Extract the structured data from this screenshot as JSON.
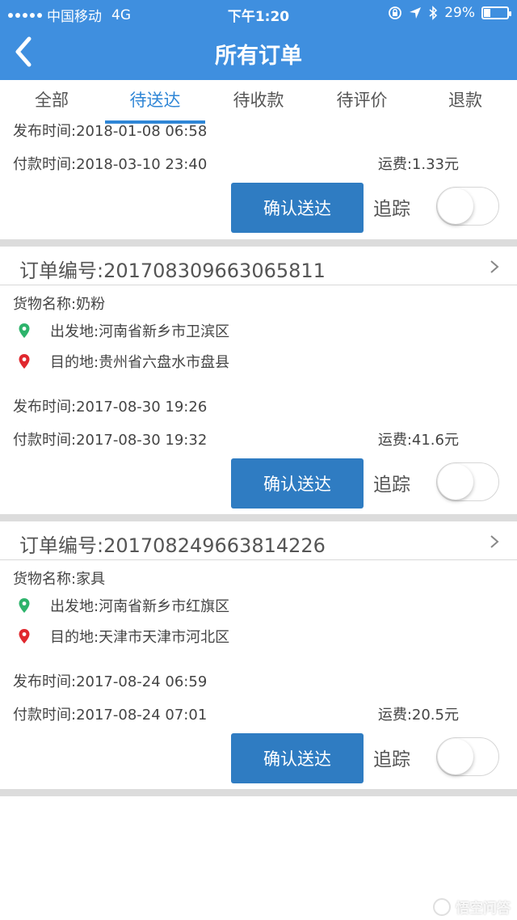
{
  "status_bar": {
    "carrier": "中国移动",
    "network": "4G",
    "time": "下午1:20",
    "battery": "29%",
    "battery_level": 0.29
  },
  "header": {
    "title": "所有订单",
    "back_icon": "back-arrow-icon"
  },
  "tabs": [
    {
      "label": "全部",
      "active": false
    },
    {
      "label": "待送达",
      "active": true
    },
    {
      "label": "待收款",
      "active": false
    },
    {
      "label": "待评价",
      "active": false
    },
    {
      "label": "退款",
      "active": false
    }
  ],
  "orders": [
    {
      "publish_time": "发布时间:2018-01-08 06:58",
      "pay_time": "付款时间:2018-03-10 23:40",
      "fee": "运费:1.33元",
      "confirm_label": "确认送达",
      "track_label": "追踪",
      "tracking_on": false
    },
    {
      "order_no": "订单编号:201708309663065811",
      "goods": "货物名称:奶粉",
      "origin": "出发地:河南省新乡市卫滨区",
      "destination": "目的地:贵州省六盘水市盘县",
      "publish_time": "发布时间:2017-08-30 19:26",
      "pay_time": "付款时间:2017-08-30 19:32",
      "fee": "运费:41.6元",
      "confirm_label": "确认送达",
      "track_label": "追踪",
      "tracking_on": false
    },
    {
      "order_no": "订单编号:201708249663814226",
      "goods": "货物名称:家具",
      "origin": "出发地:河南省新乡市红旗区",
      "destination": "目的地:天津市天津市河北区",
      "publish_time": "发布时间:2017-08-24 06:59",
      "pay_time": "付款时间:2017-08-24 07:01",
      "fee": "运费:20.5元",
      "confirm_label": "确认送达",
      "track_label": "追踪",
      "tracking_on": false
    }
  ],
  "colors": {
    "header_bg": "#3f8fdf",
    "tab_active": "#2f86d6",
    "button_bg": "#2f7cc2",
    "origin_pin": "#2db36b",
    "destination_pin": "#e0282e"
  },
  "watermark": "悟空问答"
}
